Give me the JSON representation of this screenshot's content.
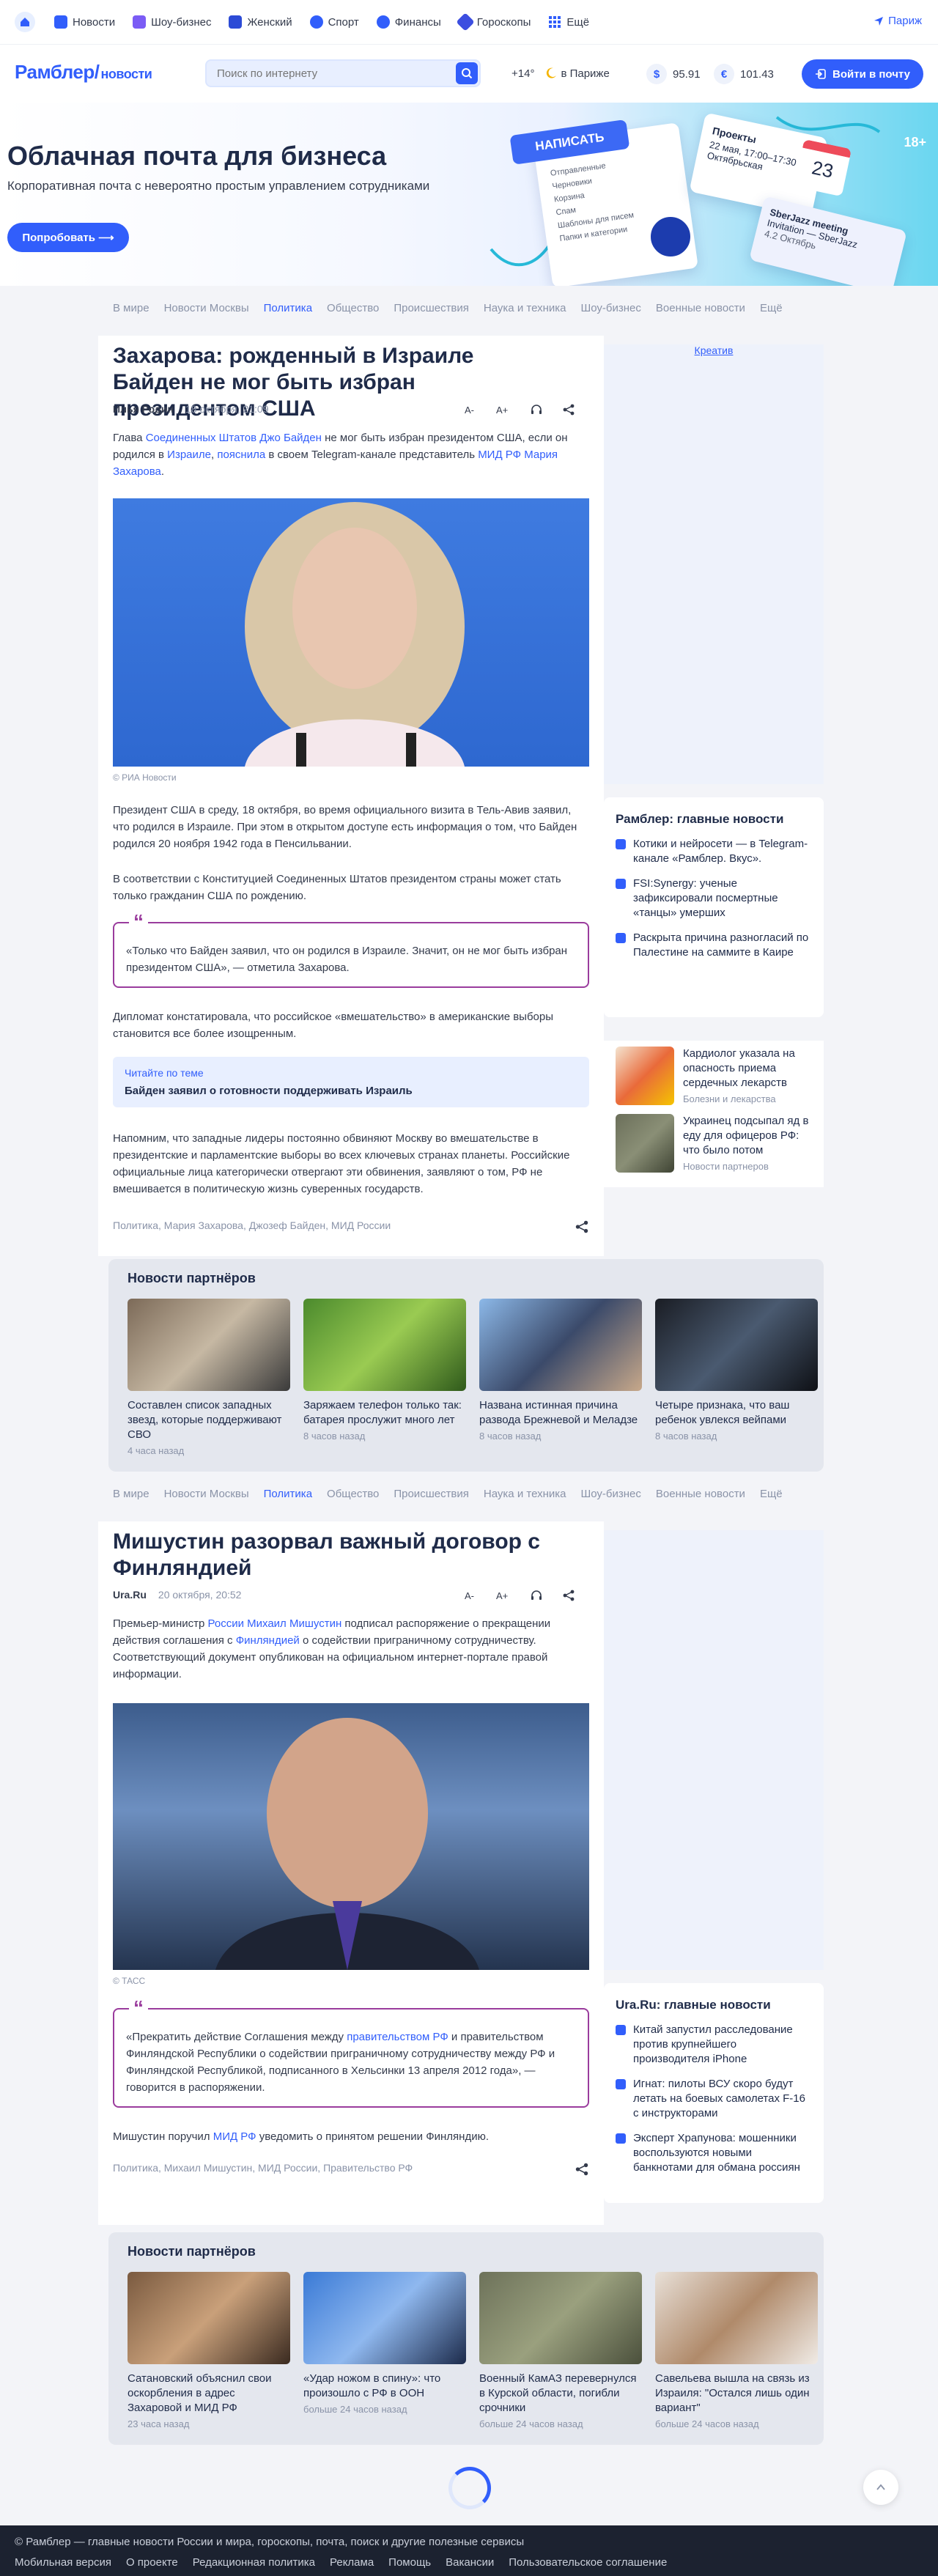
{
  "topbar": {
    "items": [
      {
        "label": "Новости"
      },
      {
        "label": "Шоу-бизнес"
      },
      {
        "label": "Женский"
      },
      {
        "label": "Спорт"
      },
      {
        "label": "Финансы"
      },
      {
        "label": "Гороскопы"
      },
      {
        "label": "Ещё"
      }
    ],
    "region": "Париж"
  },
  "header": {
    "logo": "Рамблер/",
    "logo_sub": "новости",
    "search_placeholder": "Поиск по интернету",
    "weather_temp": "+14°",
    "weather_city": "в Париже",
    "usd_sign": "$",
    "usd": "95.91",
    "eur_sign": "€",
    "eur": "101.43",
    "login": "Войти в почту"
  },
  "banner": {
    "title": "Облачная почта для бизнеса",
    "subtitle": "Корпоративная почта с невероятно простым управлением сотрудниками",
    "button": "Попробовать ⟶",
    "age": "18+",
    "compose": "НАПИСАТЬ",
    "card_title": "Проекты",
    "card_date": "22 мая, 17:00–17:30",
    "card_place": "Октябрьская",
    "card_day": "23",
    "meeting_title": "SberJazz meeting",
    "meeting_sub": "Invitation — SberJazz",
    "meeting_date": "4.2 Октябрь",
    "folders": [
      "Отправленные",
      "Черновики",
      "Корзина",
      "Спам",
      "Шаблоны для писем",
      "Папки и категории"
    ]
  },
  "nav": {
    "items": [
      "В мире",
      "Новости Москвы",
      "Политика",
      "Общество",
      "Происшествия",
      "Наука и техника",
      "Шоу-бизнес",
      "Военные новости",
      "Ещё"
    ],
    "active": "Политика"
  },
  "article1": {
    "title": "Захарова: рожденный в Израиле Байден не мог быть избран президентом США",
    "author": "Илья Родин",
    "date": "18 октября, 21:09",
    "tools": [
      "A-",
      "A+"
    ],
    "lead_1": "Глава ",
    "lead_link1": "Соединенных Штатов Джо Байден",
    "lead_2": " не мог быть избран президентом США, если он родился в ",
    "lead_link2": "Израиле",
    "lead_3": ", ",
    "lead_link3": "пояснила",
    "lead_4": " в своем Telegram-канале представитель ",
    "lead_link4": "МИД РФ Мария Захарова",
    "lead_5": ".",
    "photo_credit": "© РИА Новости",
    "p1": "Президент США в среду, 18 октября, во время официального визита в Тель-Авив заявил, что родился в Израиле. При этом в открытом доступе есть информация о том, что Байден родился 20 ноября 1942 года в Пенсильвании.",
    "p2": "В соответствии с Конституцией Соединенных Штатов президентом страны может стать только гражданин США по рождению.",
    "quote": "«Только что Байден заявил, что он родился в Израиле. Значит, он не мог быть избран президентом США», — отметила Захарова.",
    "p3": "Дипломат констатировала, что российское «вмешательство» в американские выборы становится все более изощренным.",
    "readmore_label": "Читайте по теме",
    "readmore_title": "Байден заявил о готовности поддерживать Израиль",
    "p4": "Напомним, что западные лидеры постоянно обвиняют Москву во вмешательстве в президентские и парламентские выборы во всех ключевых странах планеты. Российские официальные лица категорически отвергают эти обвинения, заявляют о том, РФ не вмешивается в политическую жизнь суверенных государств.",
    "tags": "Политика,   Мария Захарова,   Джозеф Байден,   МИД России"
  },
  "ad1_link": "Креатив",
  "side1": {
    "title": "Рамблер: главные новости",
    "items": [
      "Котики и нейросети — в Telegram-канале «Рамблер. Вкус».",
      "FSI:Synergy: ученые зафиксировали посмертные «танцы» умерших",
      "Раскрыта причина разногласий по Палестине на саммите в Каире"
    ]
  },
  "side_teasers": [
    {
      "title": "Кардиолог указала на опасность приема сердечных лекарств",
      "source": "Болезни и лекарства"
    },
    {
      "title": "Украинец подсыпал яд в еду для офицеров РФ: что было потом",
      "source": "Новости партнеров"
    }
  ],
  "partners1": {
    "title": "Новости партнёров",
    "items": [
      {
        "title": "Составлен список западных звезд, которые поддерживают СВО",
        "time": "4 часа назад"
      },
      {
        "title": "Заряжаем телефон только так: батарея прослужит много лет",
        "time": "8 часов назад"
      },
      {
        "title": "Названа истинная причина развода Брежневой и Меладзе",
        "time": "8 часов назад"
      },
      {
        "title": "Четыре признака, что ваш ребенок увлекся вейпами",
        "time": "8 часов назад"
      }
    ]
  },
  "article2": {
    "title": "Мишустин разорвал важный договор с Финляндией",
    "author": "Ura.Ru",
    "date": "20 октября, 20:52",
    "lead_1": "Премьер-министр ",
    "lead_link1": "России Михаил Мишустин",
    "lead_2": " подписал распоряжение о прекращении действия соглашения с ",
    "lead_link2": "Финляндией",
    "lead_3": " о содействии приграничному сотрудничеству. Соответствующий документ опубликован на официальном интернет-портале правой информации.",
    "photo_credit": "© ТАСС",
    "quote_1": "«Прекратить действие Соглашения между ",
    "quote_link": "правительством РФ",
    "quote_2": " и правительством Финляндской Республики о содействии приграничному сотрудничеству между РФ и Финляндской Республикой, подписанного в Хельсинки 13 апреля 2012 года», — говорится в распоряжении.",
    "p1_1": "Мишустин поручил ",
    "p1_link": "МИД РФ",
    "p1_2": " уведомить о принятом решении Финляндию.",
    "tags": "Политика,   Михаил Мишустин,   МИД России,   Правительство РФ"
  },
  "side2": {
    "title": "Ura.Ru: главные новости",
    "items": [
      "Китай запустил расследование против крупнейшего производителя iPhone",
      "Игнат: пилоты ВСУ скоро будут летать на боевых самолетах F-16 с инструкторами",
      "Эксперт Храпунова: мошенники воспользуются новыми банкнотами для обмана россиян"
    ]
  },
  "partners2": {
    "title": "Новости партнёров",
    "items": [
      {
        "title": "Сатановский объяснил свои оскорбления в адрес Захаровой и МИД РФ",
        "time": "23 часа назад"
      },
      {
        "title": "«Удар ножом в спину»: что произошло с РФ в ООН",
        "time": "больше 24 часов назад"
      },
      {
        "title": "Военный КамАЗ перевернулся в Курской области, погибли срочники",
        "time": "больше 24 часов назад"
      },
      {
        "title": "Савельева вышла на связь из Израиля: \"Остался лишь один вариант\"",
        "time": "больше 24 часов назад"
      }
    ]
  },
  "footer": {
    "line1": "© Рамблер — главные новости России и мира, гороскопы, почта, поиск и другие полезные сервисы",
    "links": [
      "Мобильная версия",
      "О проекте",
      "Редакционная политика",
      "Реклама",
      "Помощь",
      "Вакансии",
      "Пользовательское соглашение"
    ]
  },
  "colors": {
    "accent": "#315efb",
    "quote_border": "#9a3c9d",
    "footer_bg": "#1c2230"
  }
}
